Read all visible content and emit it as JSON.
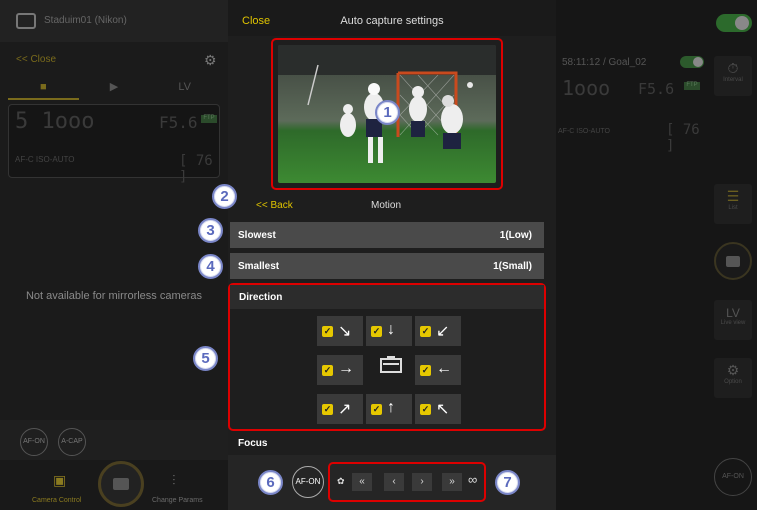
{
  "left_panel": {
    "camera_name": "Staduim01 (Nikon)",
    "close_label": "<< Close",
    "tabs": [
      "LV"
    ],
    "lcd": {
      "mode_digit": "5",
      "shutter": "1ooo",
      "aperture": "F5.6",
      "ftp_badge": "FTP",
      "af_mode": "AF-C",
      "iso": "ISO-AUTO",
      "count": "76"
    },
    "unavailable_message": "Not available for mirrorless cameras",
    "buttons": {
      "af_on": "AF-ON",
      "a_cap": "A-CAP"
    },
    "bottom": {
      "camera_control": "Camera Control",
      "change_params": "Change Params"
    }
  },
  "modal": {
    "close_label": "Close",
    "title": "Auto capture settings",
    "back_label": "<< Back",
    "subtitle": "Motion",
    "rows": [
      {
        "label": "Slowest",
        "value": "1(Low)"
      },
      {
        "label": "Smallest",
        "value": "1(Small)"
      }
    ],
    "direction_header": "Direction",
    "directions": [
      {
        "arrow": "↘",
        "checked": true
      },
      {
        "arrow": "↓",
        "checked": true
      },
      {
        "arrow": "↙",
        "checked": true
      },
      {
        "arrow": "→",
        "checked": true
      },
      {
        "arrow": "←",
        "checked": true
      },
      {
        "arrow": "↗",
        "checked": true
      },
      {
        "arrow": "↑",
        "checked": true
      },
      {
        "arrow": "↖",
        "checked": true
      }
    ],
    "focus_header": "Focus",
    "af_on_label": "AF-ON",
    "focus_buttons": [
      "«",
      "‹",
      "›",
      "»"
    ],
    "infinity": "∞"
  },
  "callouts": [
    "1",
    "2",
    "3",
    "4",
    "5",
    "6",
    "7"
  ],
  "right_panel": {
    "status": "58:11:12 / Goal_02",
    "lcd": {
      "shutter": "1ooo",
      "aperture": "F5.6",
      "ftp_badge": "FTP",
      "af_mode": "AF-C",
      "iso": "ISO-AUTO",
      "count": "76"
    },
    "interval_label": "Interval",
    "list_label": "List",
    "lv_label": "LV",
    "live_view_label": "Live view",
    "option_label": "Option",
    "af_on": "AF-ON"
  },
  "colors": {
    "accent_yellow": "#e0c400",
    "callout_border": "#7a86c8",
    "highlight_red": "#dd0000"
  }
}
